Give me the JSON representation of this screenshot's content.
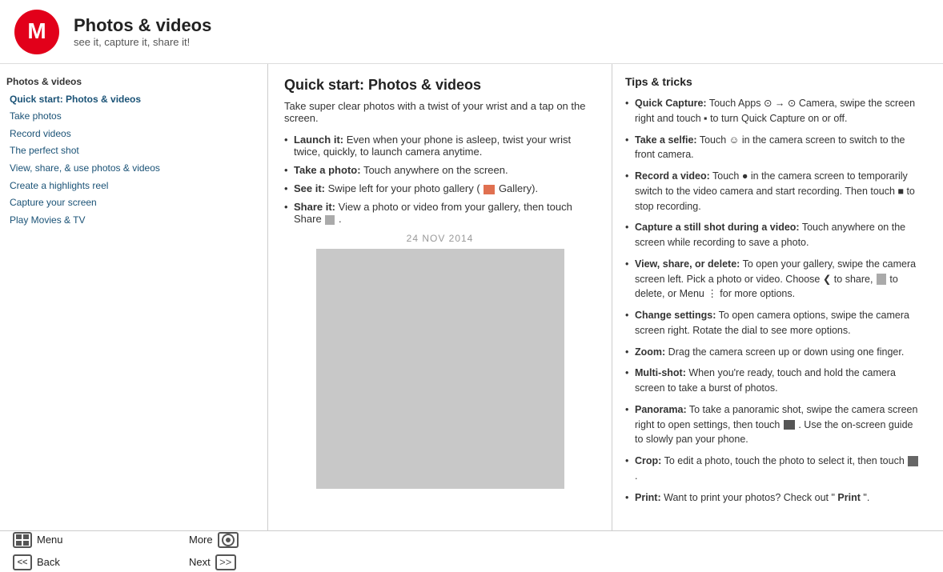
{
  "header": {
    "title": "Photos & videos",
    "subtitle": "see it, capture it, share it!"
  },
  "sidebar": {
    "section_title": "Photos & videos",
    "items": [
      {
        "label": "Quick start: Photos & videos",
        "active": true
      },
      {
        "label": "Take photos",
        "active": false
      },
      {
        "label": "Record videos",
        "active": false
      },
      {
        "label": "The perfect shot",
        "active": false
      },
      {
        "label": "View, share, & use photos & videos",
        "active": false
      },
      {
        "label": "Create a highlights reel",
        "active": false
      },
      {
        "label": "Capture your screen",
        "active": false
      },
      {
        "label": "Play Movies & TV",
        "active": false
      }
    ]
  },
  "main": {
    "title": "Quick start: Photos & videos",
    "intro": "Take super clear photos with a twist of your wrist and a tap on the screen.",
    "items": [
      {
        "label": "Launch it:",
        "text": "Even when your phone is asleep, twist your wrist twice, quickly, to launch camera anytime."
      },
      {
        "label": "Take a photo:",
        "text": "Touch anywhere on the screen."
      },
      {
        "label": "See it:",
        "text": "Swipe left for your photo gallery (🖼 Gallery)."
      },
      {
        "label": "Share it:",
        "text": "View a photo or video from your gallery, then touch Share □."
      }
    ],
    "date_label": "24 NOV 2014"
  },
  "tips": {
    "title": "Tips & tricks",
    "items": [
      {
        "label": "Quick Capture:",
        "text": "Touch Apps ⊙ → ⊙ Camera, swipe the screen right and touch ■ to turn Quick Capture on or off."
      },
      {
        "label": "Take a selfie:",
        "text": "Touch ☺ in the camera screen to switch to the front camera."
      },
      {
        "label": "Record a video:",
        "text": "Touch ● in the camera screen to temporarily switch to the video camera and start recording. Then touch ■ to stop recording."
      },
      {
        "label": "Capture a still shot during a video:",
        "text": "Touch anywhere on the screen while recording to save a photo."
      },
      {
        "label": "View, share, or delete:",
        "text": "To open your gallery, swipe the camera screen left. Pick a photo or video. Choose ❮ to share, 🗑 to delete, or Menu ⋮ for more options."
      },
      {
        "label": "Change settings:",
        "text": "To open camera options, swipe the camera screen right. Rotate the dial to see more options."
      },
      {
        "label": "Zoom:",
        "text": "Drag the camera screen up or down using one finger."
      },
      {
        "label": "Multi-shot:",
        "text": "When you’re ready, touch and hold the camera screen to take a burst of photos."
      },
      {
        "label": "Panorama:",
        "text": "To take a panoramic shot, swipe the camera screen right to open settings, then touch ▶. Use the on-screen guide to slowly pan your phone."
      },
      {
        "label": "Crop:",
        "text": "To edit a photo, touch the photo to select it, then touch ✏."
      },
      {
        "label": "Print:",
        "text": "Want to print your photos? Check out “Print”."
      }
    ]
  },
  "footer": {
    "menu_label": "Menu",
    "more_label": "More",
    "back_label": "Back",
    "next_label": "Next",
    "menu_icon": "⊞",
    "more_icon": "⊙",
    "back_icon": "<<",
    "next_icon": ">>"
  }
}
